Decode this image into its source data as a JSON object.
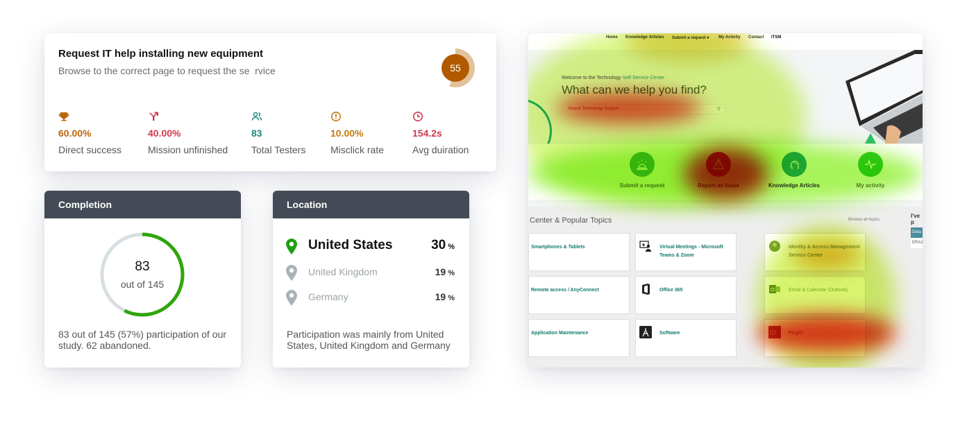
{
  "task": {
    "title": "Request IT help installing new equipment",
    "subtitle": "Browse to the correct page to request the se  rvice",
    "score": "55",
    "score_fraction": 0.55,
    "metrics": [
      {
        "icon": "trophy-icon",
        "value": "60.00%",
        "label": "Direct success",
        "color": "#b8680a"
      },
      {
        "icon": "diverge-arrow-icon",
        "value": "40.00%",
        "label": "Mission unfinished",
        "color": "#d0394e"
      },
      {
        "icon": "users-icon",
        "value": "83",
        "label": "Total Testers",
        "color": "#1e8a7e"
      },
      {
        "icon": "alert-circle-icon",
        "value": "10.00%",
        "label": "Misclick rate",
        "color": "#c27a14"
      },
      {
        "icon": "clock-icon",
        "value": "154.2s",
        "label": "Avg duiration",
        "color": "#d0394e"
      }
    ]
  },
  "completion": {
    "header": "Completion",
    "count": "83",
    "total_label": "out of 145",
    "fraction": 0.5724,
    "note": "83 out of 145 (57%) participation of our study. 62 abandoned.",
    "ring_color": "#2fa60c",
    "track_color": "#d7dfe2"
  },
  "location": {
    "header": "Location",
    "rows": [
      {
        "country": "United States",
        "percent": "30",
        "unit": "%"
      },
      {
        "country": "United Kingdom",
        "percent": "19",
        "unit": "%"
      },
      {
        "country": "Germany",
        "percent": "19",
        "unit": "%"
      }
    ],
    "note": "Participation was mainly from United States, United Kingdom and Germany"
  },
  "heatmap": {
    "nav": [
      "Home",
      "Knowledge Articles",
      "Submit a request ▾",
      "My Activity",
      "Contact",
      "ITSM"
    ],
    "welcome_prefix": "Welcome to the Technology ",
    "welcome_accent": "Self-Service Center",
    "headline": "What can we help you find?",
    "search_placeholder": "Search Technology Support",
    "actions": [
      {
        "icon": "siren-icon",
        "label": "Submit a request"
      },
      {
        "icon": "warning-icon",
        "label": "Report an Issue"
      },
      {
        "icon": "brain-circuit-icon",
        "label": "Knowledge Articles"
      },
      {
        "icon": "pulse-icon",
        "label": "My activity"
      }
    ],
    "topics_title": "Center & Popular Topics",
    "browse_link": "Browse all topics",
    "aside_title": "I've p",
    "aside_tab": "Deta",
    "aside_cell": "ERA2",
    "tiles": [
      {
        "icon": "",
        "label": "Smartphones & Tablets"
      },
      {
        "icon": "virtual-meeting-icon",
        "label": "Virtual Meetings - Microsoft Teams & Zoom"
      },
      {
        "icon": "identity-icon",
        "label": "Identity & Access Management Service Center"
      },
      {
        "icon": "",
        "label": "Remote access / AnyConnect"
      },
      {
        "icon": "office365-icon",
        "label": "Office 365"
      },
      {
        "icon": "outlook-icon",
        "label": "Email & Calendar (Outlook)"
      },
      {
        "icon": "",
        "label": "Application Maintenance"
      },
      {
        "icon": "software-icon",
        "label": "Software"
      },
      {
        "icon": "pingid-icon",
        "label": "PingID"
      }
    ]
  }
}
